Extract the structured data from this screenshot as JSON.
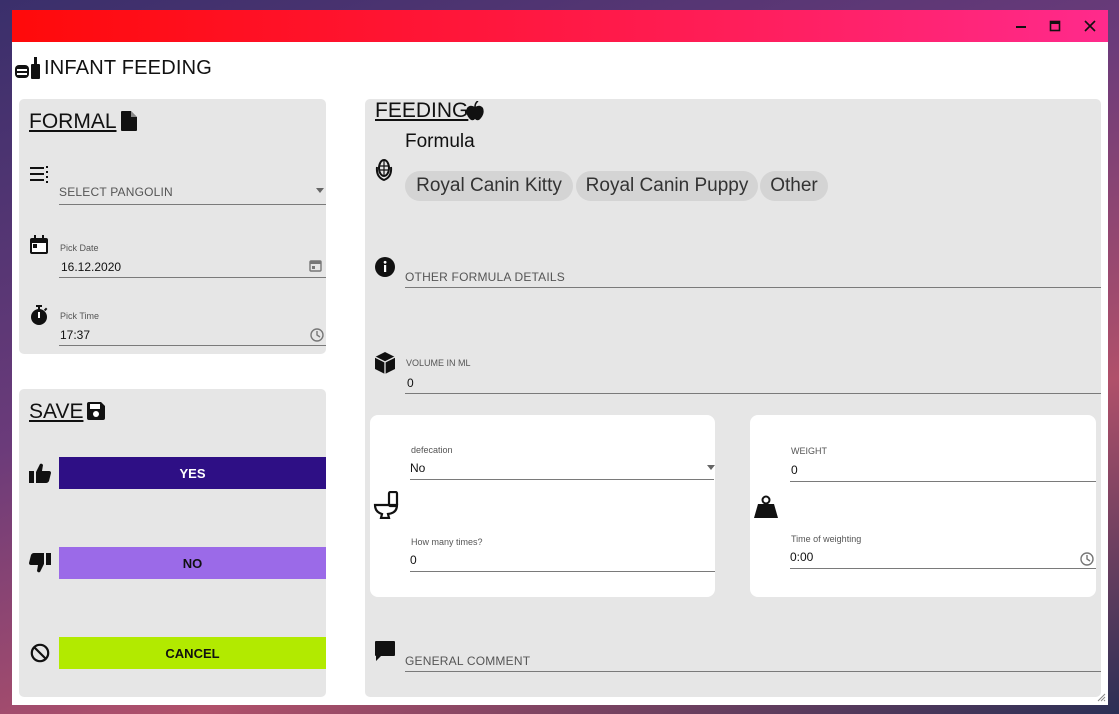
{
  "app": {
    "title": "INFANT FEEDING"
  },
  "formal": {
    "title": "FORMAL",
    "pangolin_placeholder": "SELECT PANGOLIN",
    "date_label": "Pick Date",
    "date_value": "16.12.2020",
    "time_label": "Pick Time",
    "time_value": "17:37"
  },
  "save": {
    "title": "SAVE",
    "yes_label": "YES",
    "no_label": "NO",
    "cancel_label": "CANCEL"
  },
  "feeding": {
    "title": "FEEDING",
    "formula_label": "Formula",
    "formula_options": [
      "Royal Canin Kitty",
      "Royal Canin Puppy",
      "Other"
    ],
    "other_details_placeholder": "OTHER FORMULA DETAILS",
    "volume_label": "VOLUME IN ML",
    "volume_value": "0",
    "defecation_label": "defecation",
    "defecation_value": "No",
    "times_label": "How many times?",
    "times_value": "0",
    "weight_label": "WEIGHT",
    "weight_value": "0",
    "weighting_time_label": "Time of weighting",
    "weighting_time_value": "0:00",
    "comment_placeholder": "GENERAL COMMENT"
  },
  "colors": {
    "titlebar_start": "#ff0a0a",
    "titlebar_end": "#ff2a8c",
    "yes_button": "#2e0f85",
    "no_button": "#9b6ae8",
    "cancel_button": "#b2ea00",
    "panel_bg": "#e6e6e6"
  },
  "icons": {
    "app": "baby-bottle-icon",
    "formal": "document-icon",
    "save": "floppy-disk-icon",
    "feeding": "apple-icon",
    "pangolin": "list-icon",
    "date": "calendar-icon",
    "time": "stopwatch-icon",
    "formula": "corn-icon",
    "details": "info-icon",
    "volume": "cube-icon",
    "defecation": "toilet-icon",
    "weight": "weight-icon",
    "comment": "comment-icon",
    "yes": "thumbs-up-icon",
    "no": "thumbs-down-icon",
    "cancel": "ban-icon"
  }
}
